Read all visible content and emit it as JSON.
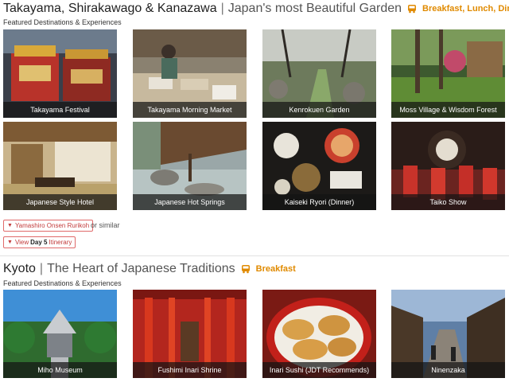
{
  "section1": {
    "title": "Takayama, Shirakawago & Kanazawa",
    "separator": "|",
    "subtitle": "Japan's most Beautiful Garden",
    "meals": [
      "Breakfast",
      "Lunch",
      "Dinner"
    ],
    "meal_separator": ",",
    "featured_label": "Featured Destinations & Experiences",
    "cards": [
      {
        "caption": "Takayama Festival",
        "icon": "festival-float-photo"
      },
      {
        "caption": "Takayama Morning Market",
        "icon": "market-photo"
      },
      {
        "caption": "Kenrokuen Garden",
        "icon": "garden-photo"
      },
      {
        "caption": "Moss Village & Wisdom Forest",
        "icon": "moss-forest-photo"
      },
      {
        "caption": "Japanese Style Hotel",
        "icon": "tatami-room-photo"
      },
      {
        "caption": "Japanese Hot Springs",
        "icon": "onsen-photo"
      },
      {
        "caption": "Kaiseki Ryori (Dinner)",
        "icon": "kaiseki-photo"
      },
      {
        "caption": "Taiko Show",
        "icon": "taiko-photo"
      }
    ],
    "hotel_option": "Yamashiro Onsen Rurikoh",
    "or_similar": "or similar",
    "itinerary": {
      "prefix": "View",
      "day": "Day 5",
      "suffix": "Itinerary"
    }
  },
  "section2": {
    "title": "Kyoto",
    "separator": "|",
    "subtitle": "The Heart of Japanese Traditions",
    "meals": [
      "Breakfast"
    ],
    "featured_label": "Featured Destinations & Experiences",
    "cards": [
      {
        "caption": "Miho Museum",
        "icon": "museum-photo"
      },
      {
        "caption": "Fushimi Inari Shrine",
        "icon": "torii-photo"
      },
      {
        "caption": "Inari Sushi (JDT Recommends)",
        "icon": "sushi-photo"
      },
      {
        "caption": "Ninenzaka",
        "icon": "street-photo"
      }
    ]
  },
  "colors": {
    "accent": "#e08a00",
    "pill_border": "#e06a6a",
    "pill_text": "#c23b3b"
  }
}
